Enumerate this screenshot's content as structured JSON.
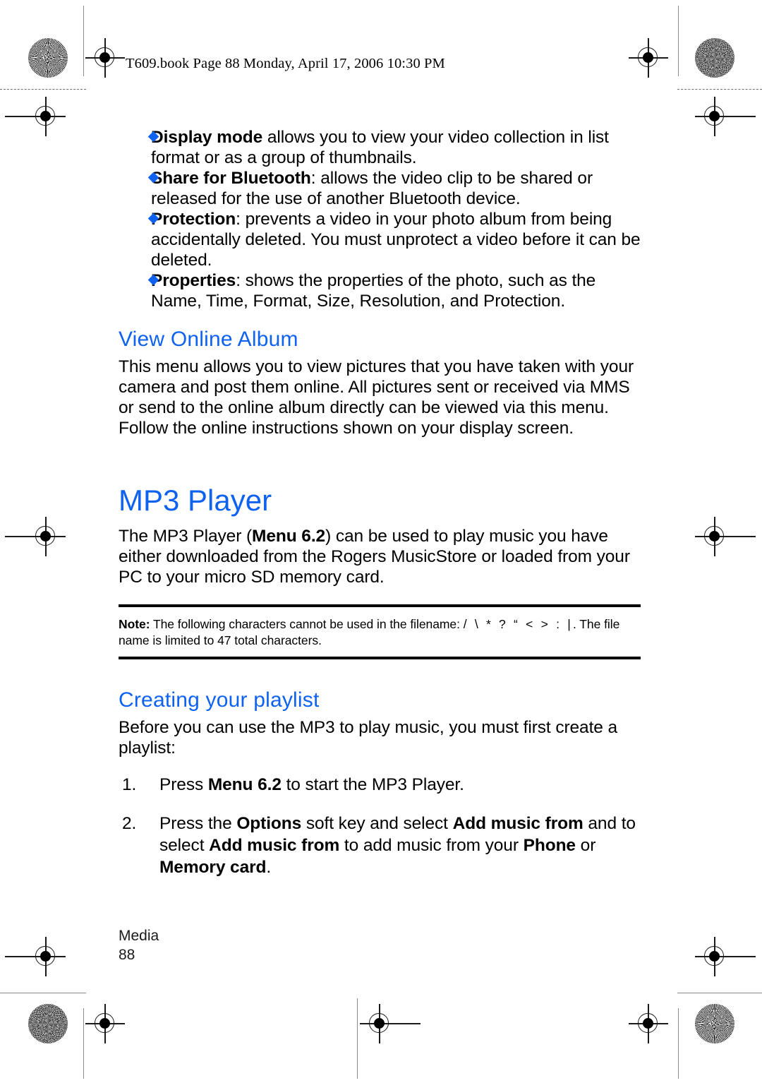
{
  "page": {
    "running_header": "T609.book  Page 88  Monday, April 17, 2006  10:30 PM",
    "accent_color": "#0f62f0",
    "text_color": "#000000",
    "background_color": "#ffffff"
  },
  "bullets": [
    {
      "term": "Display mode",
      "separator": " ",
      "text": "allows you to view your video collection in list format or as a group of thumbnails."
    },
    {
      "term": "Share for Bluetooth",
      "separator": ": ",
      "text": "allows the video clip to be shared or released for the use of another Bluetooth device."
    },
    {
      "term": "Protection",
      "separator": ": ",
      "text": "prevents a video in your photo album from being accidentally deleted. You must unprotect a video before it can be deleted."
    },
    {
      "term": "Properties",
      "separator": ": ",
      "text": "shows the properties of the photo, such as the Name, Time, Format, Size, Resolution, and Protection."
    }
  ],
  "view_online_album": {
    "heading": "View Online Album",
    "paragraph": "This menu allows you to view pictures that you have taken with your camera and post them online. All pictures sent or received via MMS or send to the online album directly can be viewed via this menu. Follow the online instructions shown on your display screen."
  },
  "mp3_player": {
    "heading": "MP3 Player",
    "intro_before": "The MP3 Player (",
    "intro_bold": "Menu 6.2",
    "intro_after": ") can be used to play music you have either downloaded from the Rogers MusicStore or loaded from your PC to your micro SD memory card."
  },
  "note": {
    "label": "Note:",
    "text_before": " The following characters cannot be used in the filename:",
    "special_characters": "/ \\ * ? “ < > : |",
    "text_after": ". The file name is limited to 47 total characters."
  },
  "creating_playlist": {
    "heading": "Creating your playlist",
    "paragraph": "Before you can use the MP3 to play music, you must first create a playlist:",
    "steps": [
      {
        "parts": [
          {
            "text": "Press ",
            "bold": false
          },
          {
            "text": "Menu 6.2",
            "bold": true
          },
          {
            "text": " to start the MP3 Player.",
            "bold": false
          }
        ]
      },
      {
        "parts": [
          {
            "text": "Press the ",
            "bold": false
          },
          {
            "text": "Options",
            "bold": true
          },
          {
            "text": " soft key and select ",
            "bold": false
          },
          {
            "text": "Add music from",
            "bold": true
          },
          {
            "text": " and to select ",
            "bold": false
          },
          {
            "text": "Add music from",
            "bold": true
          },
          {
            "text": " to add music from your ",
            "bold": false
          },
          {
            "text": "Phone",
            "bold": true
          },
          {
            "text": " or ",
            "bold": false
          },
          {
            "text": "Memory card",
            "bold": true
          },
          {
            "text": ".",
            "bold": false
          }
        ]
      }
    ]
  },
  "footer": {
    "section": "Media",
    "page_number": "88"
  }
}
